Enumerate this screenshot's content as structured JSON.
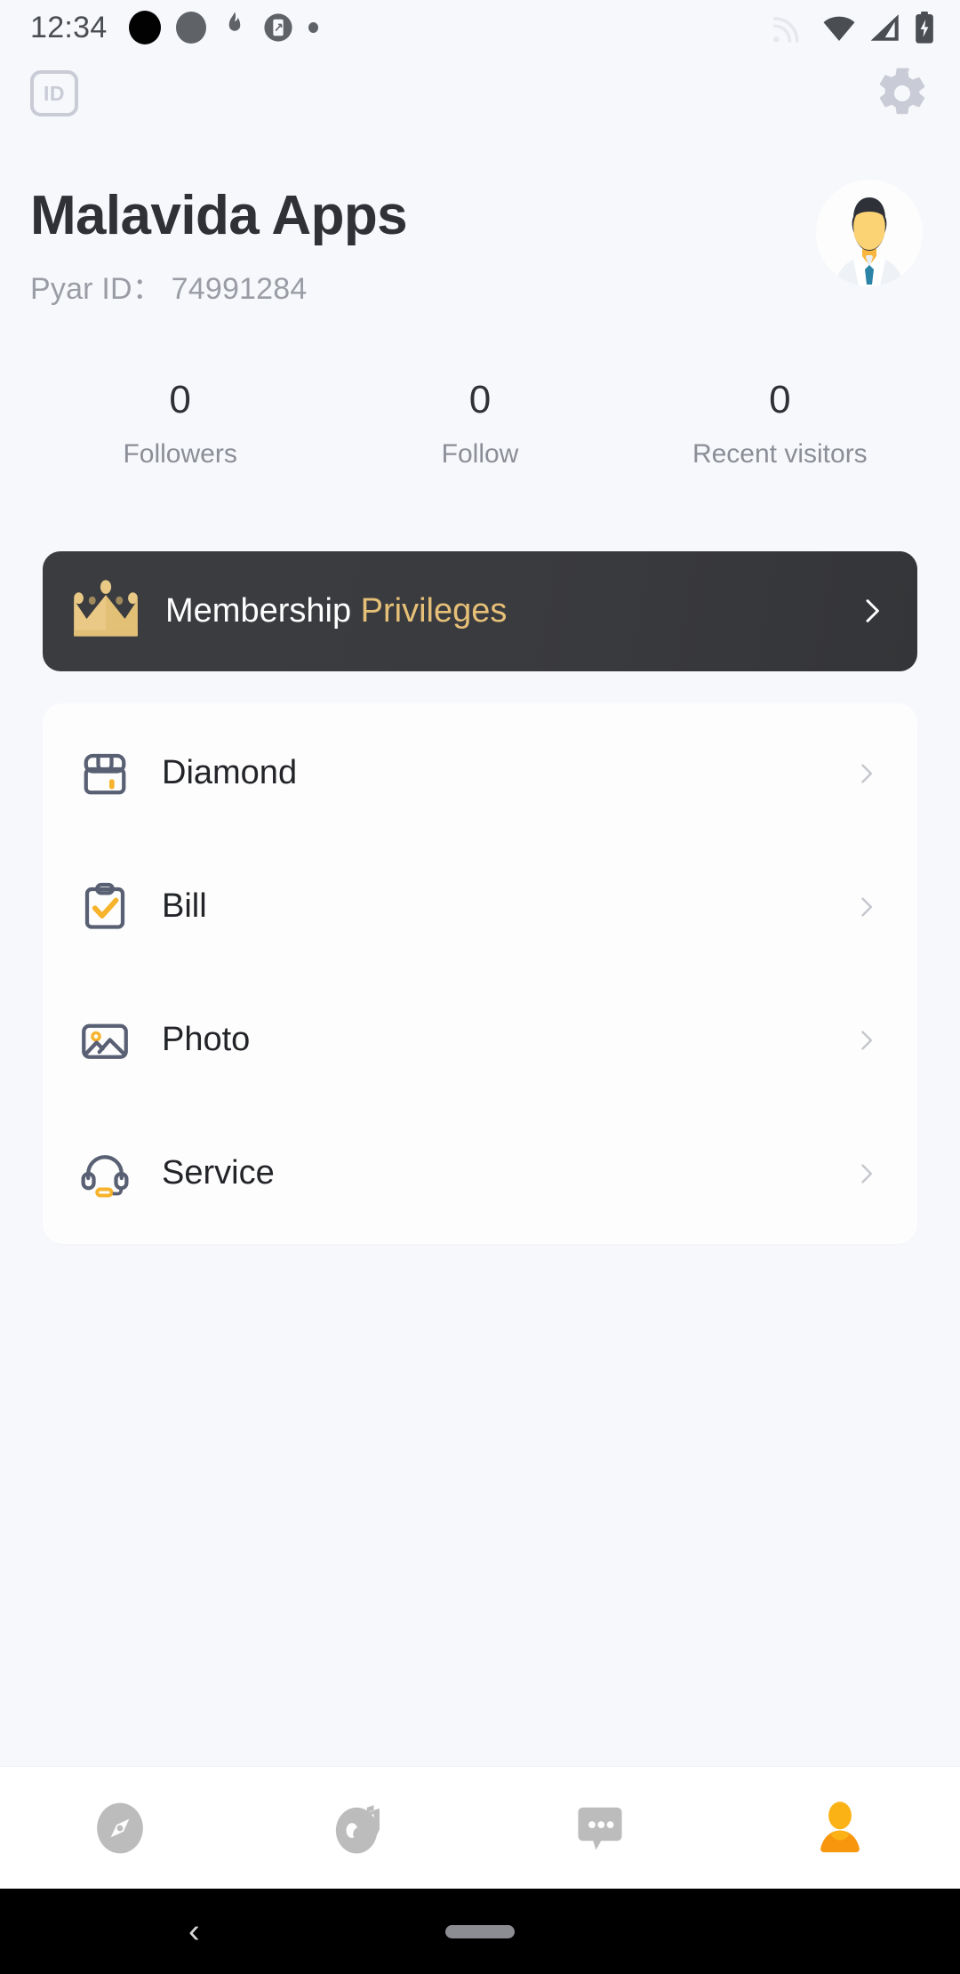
{
  "status_bar": {
    "time": "12:34",
    "left_icons": [
      "dot-black-icon",
      "dot-gray-icon",
      "flame-icon",
      "screenshot-icon",
      "dot-small-icon"
    ],
    "right_icons": [
      "cast-icon",
      "wifi-icon",
      "signal-icon",
      "battery-charging-icon"
    ]
  },
  "top_bar": {
    "id_badge_label": "ID",
    "settings_icon": "gear-icon"
  },
  "profile": {
    "username": "Malavida Apps",
    "id_label": "Pyar ID：",
    "id_value": "74991284",
    "avatar": "default-male-avatar"
  },
  "stats": [
    {
      "value": "0",
      "label": "Followers"
    },
    {
      "value": "0",
      "label": "Follow"
    },
    {
      "value": "0",
      "label": "Recent visitors"
    }
  ],
  "membership": {
    "icon": "crown-icon",
    "text_primary": "Membership",
    "text_accent": "Privileges",
    "chevron": "chevron-right-icon",
    "accent_color": "#e6c077",
    "background_color": "#3a3b3f"
  },
  "menu": [
    {
      "label": "Diamond",
      "icon": "shop-icon"
    },
    {
      "label": "Bill",
      "icon": "clipboard-check-icon"
    },
    {
      "label": "Photo",
      "icon": "image-icon"
    },
    {
      "label": "Service",
      "icon": "headset-icon"
    }
  ],
  "bottom_nav": [
    {
      "icon": "compass-icon",
      "active": false
    },
    {
      "icon": "music-disc-icon",
      "active": false
    },
    {
      "icon": "chat-bubble-icon",
      "active": false
    },
    {
      "icon": "person-icon",
      "active": true
    }
  ],
  "android_nav": {
    "back": "back-chevron-icon",
    "home": "home-pill-icon"
  },
  "colors": {
    "background": "#f7f8fc",
    "card": "#fdfdfd",
    "accent_orange": "#f9a01b",
    "icon_slate": "#596073",
    "text_primary": "#2f3136",
    "text_muted": "#8b8e96"
  }
}
